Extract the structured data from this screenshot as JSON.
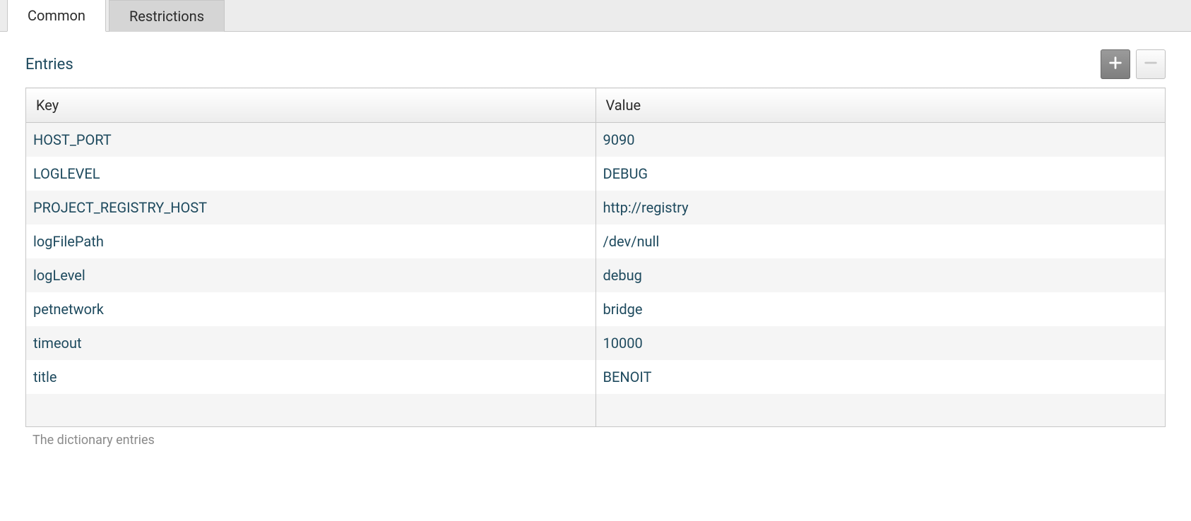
{
  "tabs": {
    "common": "Common",
    "restrictions": "Restrictions"
  },
  "section": {
    "title": "Entries",
    "caption": "The dictionary entries"
  },
  "table": {
    "headers": {
      "key": "Key",
      "value": "Value"
    },
    "rows": [
      {
        "key": "HOST_PORT",
        "value": "9090"
      },
      {
        "key": "LOGLEVEL",
        "value": "DEBUG"
      },
      {
        "key": "PROJECT_REGISTRY_HOST",
        "value": "http://registry"
      },
      {
        "key": "logFilePath",
        "value": "/dev/null"
      },
      {
        "key": "logLevel",
        "value": "debug"
      },
      {
        "key": "petnetwork",
        "value": "bridge"
      },
      {
        "key": "timeout",
        "value": "10000"
      },
      {
        "key": "title",
        "value": "BENOIT"
      }
    ]
  }
}
